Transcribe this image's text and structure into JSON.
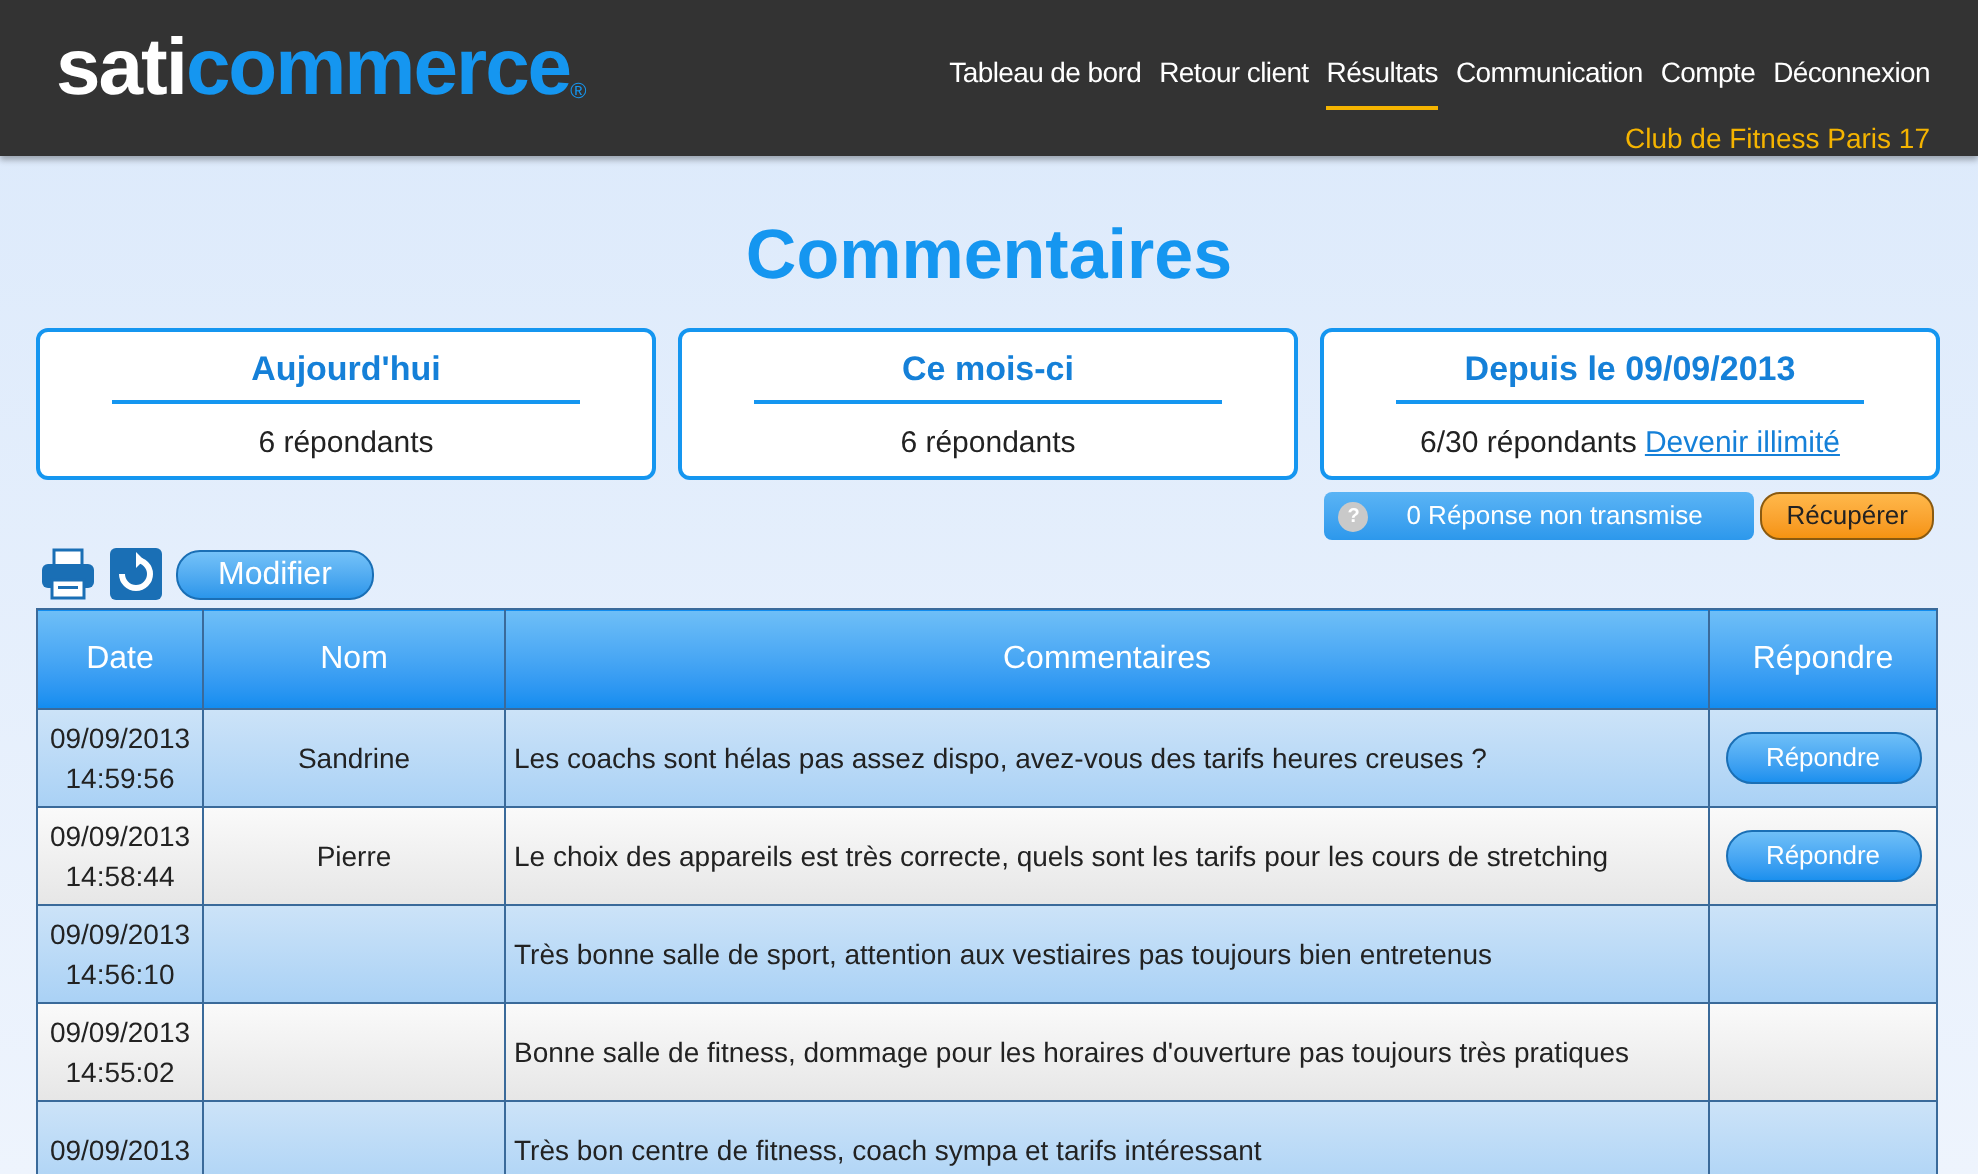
{
  "header": {
    "logo": {
      "first": "sati",
      "second": "commerce",
      "mark": "®"
    },
    "nav": [
      {
        "label": "Tableau de bord",
        "selected": false
      },
      {
        "label": "Retour client",
        "selected": false
      },
      {
        "label": "Résultats",
        "selected": true
      },
      {
        "label": "Communication",
        "selected": false
      },
      {
        "label": "Compte",
        "selected": false
      },
      {
        "label": "Déconnexion",
        "selected": false
      }
    ],
    "account": "Club de Fitness Paris 17"
  },
  "title": "Commentaires",
  "stats": [
    {
      "title": "Aujourd'hui",
      "text": "6 répondants"
    },
    {
      "title": "Ce mois-ci",
      "text": "6 répondants"
    },
    {
      "title": "Depuis le 09/09/2013",
      "text": "6/30 répondants",
      "link": "Devenir illimité"
    }
  ],
  "pending": {
    "help": "?",
    "label": "0 Réponse non transmise",
    "button": "Récupérer"
  },
  "toolbar": {
    "button": "Modifier"
  },
  "table": {
    "columns": [
      "Date",
      "Nom",
      "Commentaires",
      "Répondre"
    ],
    "rows": [
      {
        "date": "09/09/2013",
        "time": "14:59:56",
        "name": "Sandrine",
        "comment": "Les coachs sont hélas pas assez dispo, avez-vous des tarifs heures creuses ?",
        "reply": "Répondre"
      },
      {
        "date": "09/09/2013",
        "time": "14:58:44",
        "name": "Pierre",
        "comment": "Le choix des appareils est très correcte, quels sont les tarifs pour les cours de stretching",
        "reply": "Répondre"
      },
      {
        "date": "09/09/2013",
        "time": "14:56:10",
        "comment": "Très bonne salle de sport, attention aux vestiaires pas toujours bien entretenus"
      },
      {
        "date": "09/09/2013",
        "time": "14:55:02",
        "comment": "Bonne salle de fitness, dommage pour les horaires d'ouverture pas toujours très pratiques"
      },
      {
        "date": "09/09/2013",
        "comment": "Très bon centre de fitness, coach sympa et tarifs intéressant"
      }
    ]
  }
}
